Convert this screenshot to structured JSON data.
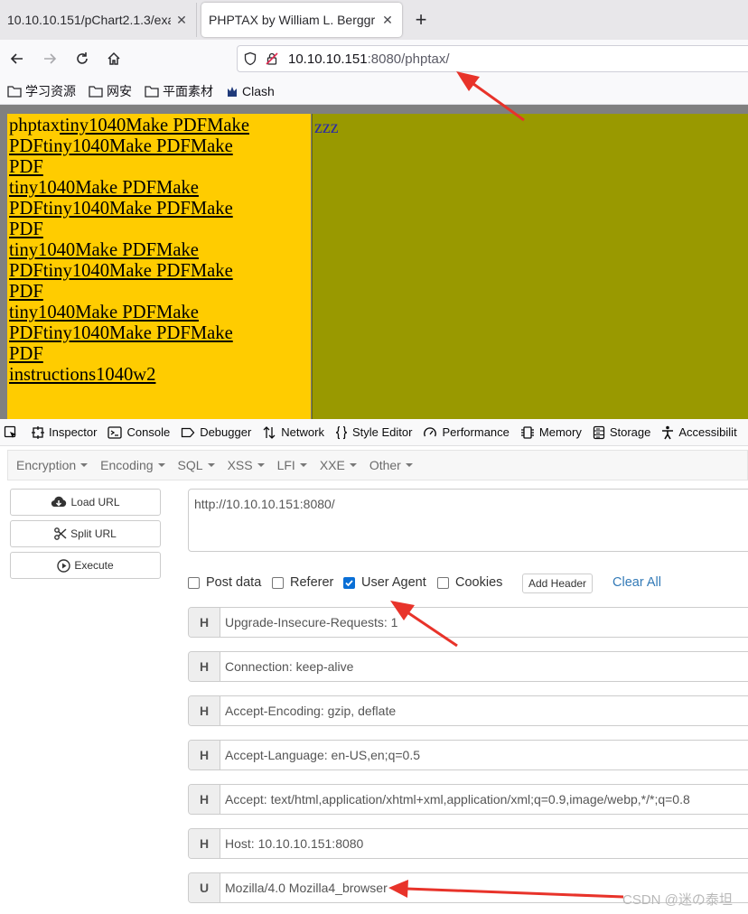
{
  "browser": {
    "tabs": [
      {
        "label": "10.10.10.151/pChart2.1.3/exar",
        "close": "✕"
      },
      {
        "label": "PHPTAX by William L. Berggr",
        "close": "✕"
      }
    ],
    "new_tab": "+",
    "url": {
      "host": "10.10.10.151",
      "rest": ":8080/phptax/"
    },
    "bookmarks": [
      {
        "label": "学习资源",
        "icon": "folder-icon"
      },
      {
        "label": "网安",
        "icon": "folder-icon"
      },
      {
        "label": "平面素材",
        "icon": "folder-icon"
      },
      {
        "label": "Clash",
        "icon": "clash-icon"
      }
    ]
  },
  "page": {
    "left_lines": [
      {
        "a": "phptax",
        "b": "tiny1040Make PDFMake"
      },
      {
        "a": "",
        "b": "PDFtiny1040Make PDFMake"
      },
      {
        "a": "",
        "b": "PDF"
      },
      {
        "a": "",
        "b": "tiny1040Make PDFMake"
      },
      {
        "a": "",
        "b": "PDFtiny1040Make PDFMake"
      },
      {
        "a": "",
        "b": "PDF"
      },
      {
        "a": "",
        "b": "tiny1040Make PDFMake"
      },
      {
        "a": "",
        "b": "PDFtiny1040Make PDFMake"
      },
      {
        "a": "",
        "b": "PDF"
      },
      {
        "a": "",
        "b": "tiny1040Make PDFMake"
      },
      {
        "a": "",
        "b": "PDFtiny1040Make PDFMake"
      },
      {
        "a": "",
        "b": "PDF"
      },
      {
        "a": "",
        "b": "instructions1040w2"
      }
    ],
    "right_text": "zzz"
  },
  "devtools": {
    "tabs": [
      "Inspector",
      "Console",
      "Debugger",
      "Network",
      "Style Editor",
      "Performance",
      "Memory",
      "Storage",
      "Accessibilit"
    ]
  },
  "hackbar": {
    "menu": [
      "Encryption",
      "Encoding",
      "SQL",
      "XSS",
      "LFI",
      "XXE",
      "Other"
    ],
    "buttons": {
      "load": "Load URL",
      "split": "Split URL",
      "execute": "Execute"
    },
    "url_value": "http://10.10.10.151:8080/",
    "options": [
      {
        "label": "Post data",
        "checked": false
      },
      {
        "label": "Referer",
        "checked": false
      },
      {
        "label": "User Agent",
        "checked": true
      },
      {
        "label": "Cookies",
        "checked": false
      }
    ],
    "add_header": "Add Header",
    "clear_all": "Clear All",
    "headers": [
      {
        "key": "H",
        "value": "Upgrade-Insecure-Requests: 1"
      },
      {
        "key": "H",
        "value": "Connection: keep-alive"
      },
      {
        "key": "H",
        "value": "Accept-Encoding: gzip, deflate"
      },
      {
        "key": "H",
        "value": "Accept-Language: en-US,en;q=0.5"
      },
      {
        "key": "H",
        "value": "Accept: text/html,application/xhtml+xml,application/xml;q=0.9,image/webp,*/*;q=0.8"
      },
      {
        "key": "H",
        "value": "Host: 10.10.10.151:8080"
      },
      {
        "key": "U",
        "value": "Mozilla/4.0 Mozilla4_browser"
      }
    ]
  },
  "watermark": "CSDN @迷の泰坦",
  "colors": {
    "accent_arrow": "#e8332a",
    "left_frame": "#ffcc00",
    "right_frame": "#999900",
    "checkbox": "#0a6fd6",
    "link": "#337ab7"
  }
}
